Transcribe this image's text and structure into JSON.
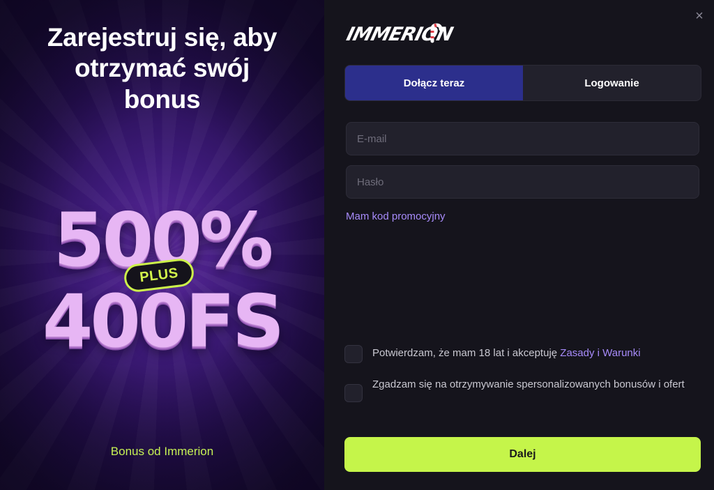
{
  "promo": {
    "title_line1": "Zarejestruj się, aby",
    "title_line2": "otrzymać swój",
    "title_line3": "bonus",
    "percent": "500%",
    "plus": "PLUS",
    "free_spins": "400FS",
    "bonus_link": "Bonus od Immerion",
    "bg_color": "#3d1a78",
    "accent_color": "#c6f154"
  },
  "header": {
    "logo_text": "IMMERION",
    "close_label": "×"
  },
  "tabs": [
    {
      "label": "Dołącz teraz",
      "active": true
    },
    {
      "label": "Logowanie",
      "active": false
    }
  ],
  "form": {
    "email_placeholder": "E-mail",
    "email_value": "",
    "password_placeholder": "Hasło",
    "password_value": "",
    "promo_code_link": "Mam kod promocyjny",
    "terms_text": "Potwierdzam, że mam 18 lat i akceptuję",
    "terms_link": "Zasady i Warunki",
    "terms_checked": false,
    "offers_text": "Zgadzam się na otrzymywanie spersonalizowanych bonusów i ofert",
    "offers_checked": false,
    "submit_label": "Dalej"
  },
  "colors": {
    "panel_bg": "#15141c",
    "active_tab": "#2c2f8c",
    "link": "#a78bfa",
    "submit": "#c5f54a"
  }
}
